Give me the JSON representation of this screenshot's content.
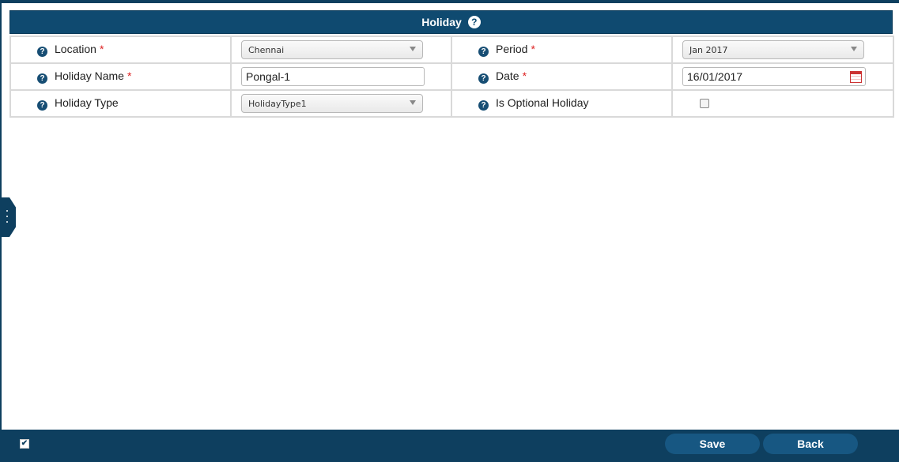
{
  "panel": {
    "title": "Holiday"
  },
  "form": {
    "location": {
      "label": "Location",
      "required": "*",
      "value": "Chennai"
    },
    "period": {
      "label": "Period",
      "required": "*",
      "value": "Jan 2017"
    },
    "holiday_name": {
      "label": "Holiday Name",
      "required": "*",
      "value": "Pongal-1"
    },
    "date": {
      "label": "Date",
      "required": "*",
      "value": "16/01/2017"
    },
    "holiday_type": {
      "label": "Holiday Type",
      "value": "HolidayType1"
    },
    "is_optional": {
      "label": "Is Optional Holiday",
      "checked": false
    }
  },
  "footer": {
    "save_label": "Save",
    "back_label": "Back"
  },
  "colors": {
    "header": "#0f4a70",
    "footer": "#0e3f5f",
    "button": "#175782",
    "required": "#dd2222"
  },
  "icons": {
    "help": "question-circle-icon",
    "calendar": "calendar-icon",
    "dropdown": "chevron-down-icon"
  }
}
